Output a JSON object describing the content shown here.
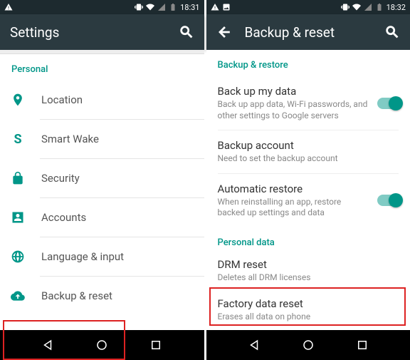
{
  "left": {
    "statusbar": {
      "time": "18:31"
    },
    "appbar": {
      "title": "Settings"
    },
    "section": "Personal",
    "items": [
      {
        "label": "Location"
      },
      {
        "label": "Smart Wake"
      },
      {
        "label": "Security"
      },
      {
        "label": "Accounts"
      },
      {
        "label": "Language & input"
      },
      {
        "label": "Backup & reset"
      }
    ]
  },
  "right": {
    "statusbar": {
      "time": "18:32"
    },
    "appbar": {
      "title": "Backup & reset"
    },
    "section1": "Backup & restore",
    "backup_my_data": {
      "title": "Back up my data",
      "sub": "Back up app data, Wi-Fi passwords, and other settings to Google servers"
    },
    "backup_account": {
      "title": "Backup account",
      "sub": "Need to set the backup account"
    },
    "auto_restore": {
      "title": "Automatic restore",
      "sub": "When reinstalling an app, restore backed up settings and data"
    },
    "section2": "Personal data",
    "drm_reset": {
      "title": "DRM reset",
      "sub": "Deletes all DRM licenses"
    },
    "factory_reset": {
      "title": "Factory data reset",
      "sub": "Erases all data on phone"
    }
  }
}
